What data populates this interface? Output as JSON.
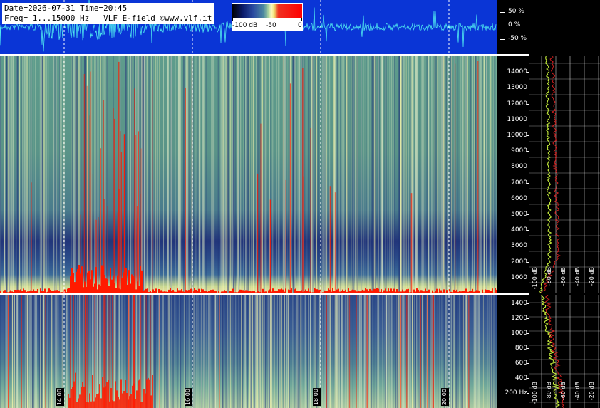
{
  "header": {
    "line1": "Date=2026-07-31 Time=20:45",
    "line2": "Freq= 1...15000 Hz   VLF E-field ©www.vlf.it"
  },
  "amplitude_scale": [
    "50 %",
    "0 %",
    "-50 %"
  ],
  "colorbar": {
    "labels": [
      "-100 dB",
      "-50",
      "0"
    ]
  },
  "colors": {
    "wave_bg": "#0a35d6",
    "wave_trace": "#4ee8f0",
    "sferic": "#ff1a00",
    "profile_green": "#c8f03c",
    "profile_red": "#e02020"
  },
  "chart_data": [
    {
      "type": "heatmap",
      "title": "",
      "panel": "upper spectrogram",
      "ylabel": "",
      "y_ticks": [
        "14000",
        "13000",
        "12000",
        "11000",
        "10000",
        "9000",
        "8000",
        "7000",
        "6000",
        "5000",
        "4000",
        "3000",
        "2000",
        "1000"
      ],
      "ylim": [
        0,
        15000
      ],
      "x_ticks": [
        "14:00",
        "16:00",
        "18:00",
        "20:00"
      ],
      "xlim": [
        "13:15",
        "20:45"
      ],
      "profile_db_ticks": [
        "-100 dB",
        "-80 dB",
        "-60 dB",
        "-40 dB",
        "-20 dB"
      ]
    },
    {
      "type": "heatmap",
      "panel": "lower spectrogram",
      "y_ticks": [
        "1400",
        "1200",
        "1000",
        "800",
        "600",
        "400",
        "200 Hz"
      ],
      "ylim": [
        0,
        1500
      ],
      "x_ticks": [
        "14:00",
        "16:00",
        "18:00",
        "20:00"
      ],
      "profile_db_ticks": [
        "-100 dB",
        "-80 dB",
        "-60 dB",
        "-40 dB",
        "-20 dB"
      ]
    }
  ]
}
